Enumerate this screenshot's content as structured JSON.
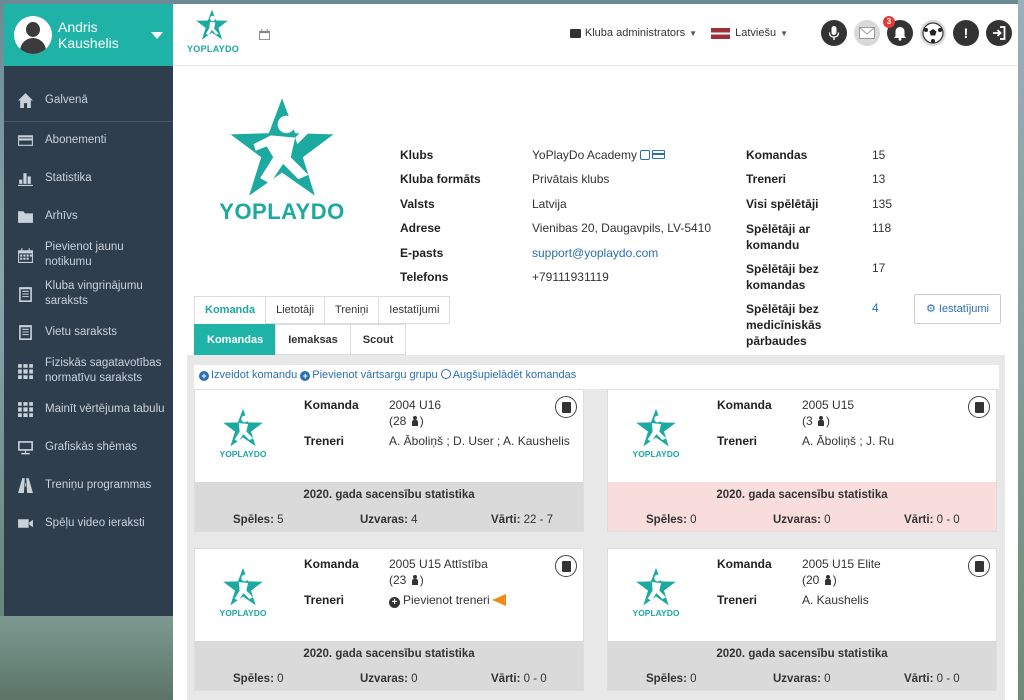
{
  "user": {
    "name_line1": "Andris",
    "name_line2": "Kaushelis"
  },
  "nav": [
    {
      "label": "Galvenā",
      "icon": "home-icon"
    },
    {
      "label": "Abonementi",
      "icon": "credit-card-icon"
    },
    {
      "label": "Statistika",
      "icon": "bar-chart-icon"
    },
    {
      "label": "Arhīvs",
      "icon": "folder-icon"
    },
    {
      "label": "Pievienot jaunu notikumu",
      "icon": "calendar-icon"
    },
    {
      "label": "Kluba vingrinājumu saraksts",
      "icon": "list-icon"
    },
    {
      "label": "Vietu saraksts",
      "icon": "list-icon"
    },
    {
      "label": "Fiziskās sagatavotības normatīvu saraksts",
      "icon": "grid-icon"
    },
    {
      "label": "Mainīt vērtējuma tabulu",
      "icon": "grid-icon"
    },
    {
      "label": "Grafiskās shēmas",
      "icon": "presentation-icon"
    },
    {
      "label": "Treniņu programmas",
      "icon": "road-icon"
    },
    {
      "label": "Spēļu video ieraksti",
      "icon": "video-icon"
    }
  ],
  "topbar": {
    "logo_text": "YOPLAYDO",
    "role": "Kluba administrators",
    "language": "Latviešu",
    "notifications_count": "3",
    "alert_symbol": "!"
  },
  "club": {
    "logo_text": "YOPLAYDO",
    "left": [
      {
        "label": "Klubs",
        "value": "YoPlayDo Academy"
      },
      {
        "label": "Kluba formāts",
        "value": "Privātais klubs"
      },
      {
        "label": "Valsts",
        "value": "Latvija"
      },
      {
        "label": "Adrese",
        "value": "Vienibas 20, Daugavpils, LV-5410"
      },
      {
        "label": "E-pasts",
        "value": "support@yoplaydo.com"
      },
      {
        "label": "Telefons",
        "value": "+79111931119"
      }
    ],
    "right": [
      {
        "label": "Komandas",
        "value": "15"
      },
      {
        "label": "Treneri",
        "value": "13"
      },
      {
        "label": "Visi spēlētāji",
        "value": "135"
      },
      {
        "label": "Spēlētāji ar komandu",
        "value": "118"
      },
      {
        "label": "Spēlētāji bez komandas",
        "value": "17"
      },
      {
        "label": "Spēlētāji bez medicīniskās pārbaudes",
        "value": "4"
      }
    ]
  },
  "tabs_primary": [
    "Komanda",
    "Lietotāji",
    "Treniņi",
    "Iestatījumi"
  ],
  "tabs_secondary": [
    "Komandas",
    "Iemaksas",
    "Scout"
  ],
  "settings_button": "Iestatījumi",
  "actions": [
    "Izveidot komandu",
    "Pievienot vārtsargu grupu",
    "Augšupielādēt komandas"
  ],
  "labels": {
    "team": "Komanda",
    "coaches": "Treneri",
    "stats_title": "2020. gada sacensību statistika",
    "games": "Spēles:",
    "wins": "Uzvaras:",
    "goals": "Vārti:",
    "add_coach": "Pievienot treneri",
    "logo_text": "YOPLAYDO"
  },
  "teams": [
    {
      "name": "2004 U16",
      "players": "(28",
      "coaches": "A. Āboliņš ; D. User ; A. Kaushelis",
      "games": "5",
      "wins": "4",
      "goals": "22 - 7"
    },
    {
      "name": "2005 U15",
      "players": "(3",
      "coaches": "A. Āboliņš ; J. Ru",
      "games": "0",
      "wins": "0",
      "goals": "0 - 0"
    },
    {
      "name": "2005 U15 Attīstība",
      "players": "(23",
      "coaches": "",
      "games": "0",
      "wins": "0",
      "goals": "0 - 0"
    },
    {
      "name": "2005 U15 Elite",
      "players": "(20",
      "coaches": "A. Kaushelis",
      "games": "0",
      "wins": "0",
      "goals": "0 - 0"
    }
  ],
  "colors": {
    "accent": "#1eb3a6",
    "sidebar": "#2f3e4d",
    "link": "#2a6fb0",
    "stats_red": "#f9dcdc"
  }
}
